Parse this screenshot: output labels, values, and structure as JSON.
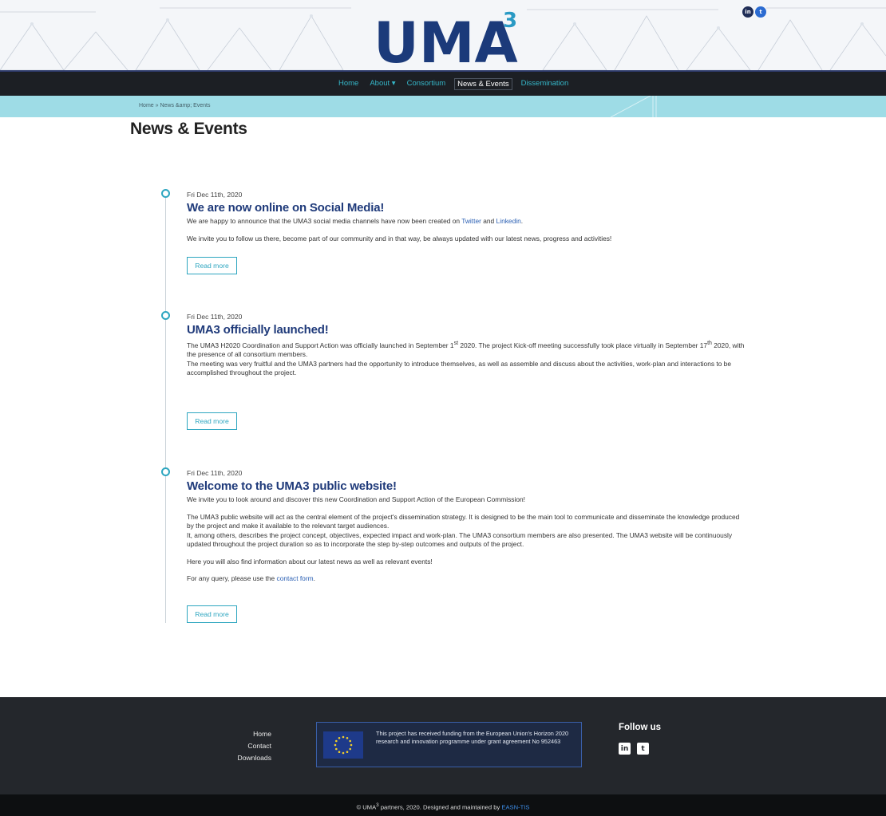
{
  "colors": {
    "accent": "#35b7c9",
    "nav_bg": "#1c1f24",
    "crumb_bg": "#9edce6",
    "title_blue": "#1f3a7a",
    "footer_bg": "#24272c"
  },
  "header": {
    "logo_text": "UMA",
    "logo_superscript": "3",
    "social": [
      {
        "icon": "linkedin-icon",
        "glyph": "in"
      },
      {
        "icon": "twitter-icon",
        "glyph": "t"
      }
    ]
  },
  "nav": {
    "items": [
      {
        "label": "Home"
      },
      {
        "label": "About ▾"
      },
      {
        "label": "Consortium"
      },
      {
        "label": "News & Events",
        "active": true
      },
      {
        "label": "Dissemination"
      }
    ]
  },
  "breadcrumb": {
    "text": "Home » News &amp; Events"
  },
  "page": {
    "title": "News & Events"
  },
  "posts": [
    {
      "date": "Fri Dec 11th, 2020",
      "title": "We are now online on Social Media!",
      "p1_pre": "We are happy to announce that the UMA3 social media channels have now been created on ",
      "p1_link1": "Twitter",
      "p1_mid": " and ",
      "p1_link2": "Linkedin",
      "p1_post": ".",
      "p2": "We invite you to follow us there, become part of our community and in that way, be always updated with our latest news, progress and activities!",
      "read_more": "Read more"
    },
    {
      "date": "Fri Dec 11th, 2020",
      "title": "UMA3 officially launched!",
      "p1_a": "The UMA3 H2020 Coordination and Support Action was officially launched in September 1",
      "p1_sup1": "st",
      "p1_b": " 2020. The project Kick-off meeting successfully took place virtually in September 17",
      "p1_sup2": "th",
      "p1_c": " 2020, with the presence of all consortium members.",
      "p2": "The meeting was very fruitful and the UMA3 partners had the opportunity to introduce themselves, as well as assemble and discuss about the activities, work-plan and interactions to be accomplished throughout the project.",
      "read_more": "Read more"
    },
    {
      "date": "Fri Dec 11th, 2020",
      "title": "Welcome to the UMA3 public website!",
      "p1": "We invite you to look around and discover this new Coordination and Support Action of the European Commission!",
      "p2": "The UMA3 public website will act as the central element of the project's dissemination strategy. It is designed to be the main tool to communicate and disseminate the knowledge produced by the project and make it available to the relevant target audiences.",
      "p3": "It, among others, describes the project concept, objectives, expected impact and work-plan. The UMA3 consortium members are also presented. The UMA3 website will be continuously updated throughout the project duration so as to incorporate the step by-step outcomes and outputs of the project.",
      "p4": "Here you will also find information about our latest news as well as relevant events!",
      "p5_pre": "For any query, please use the ",
      "p5_link": "contact form",
      "p5_post": ".",
      "read_more": "Read more"
    }
  ],
  "footer": {
    "links": [
      "Home",
      "Contact",
      "Downloads"
    ],
    "eu_text": "This project has received funding from the European Union's Horizon 2020 research and innovation programme under grant agreement No 952463",
    "follow_title": "Follow us",
    "follow_icons": [
      {
        "icon": "linkedin-icon",
        "glyph": "in"
      },
      {
        "icon": "twitter-icon",
        "glyph": "t"
      }
    ],
    "copyright_pre": "© UMA",
    "copyright_sup": "3",
    "copyright_mid": " partners, 2020. Designed and maintained by ",
    "copyright_brand": "EASN-TIS"
  }
}
